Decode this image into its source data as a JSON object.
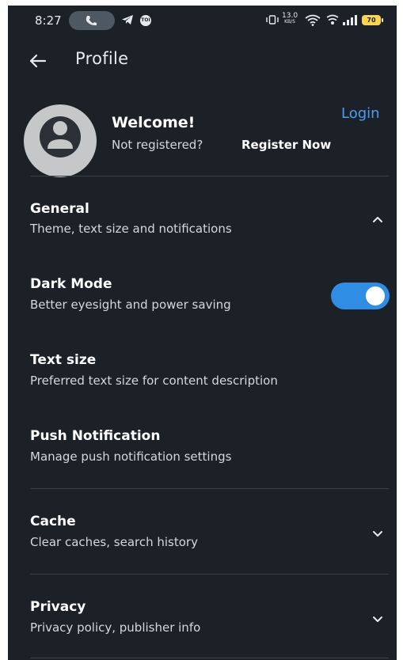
{
  "status_bar": {
    "time": "8:27",
    "toi_badge": "TOI",
    "net_speed_value": "13.0",
    "net_speed_unit": "KB/S",
    "battery_level": "70",
    "icons": [
      "phone-call-icon",
      "telegram-icon",
      "toi-icon",
      "vibrate-icon",
      "wifi-icon",
      "volte-icon",
      "signal-icon",
      "battery-icon"
    ]
  },
  "header": {
    "title": "Profile",
    "back_icon": "arrow-left-icon"
  },
  "profile": {
    "greeting": "Welcome!",
    "prompt": "Not registered?",
    "register_label": "Register Now",
    "login_label": "Login",
    "avatar_icon": "user-silhouette-icon"
  },
  "sections": {
    "general": {
      "title": "General",
      "subtitle": "Theme, text size and notifications",
      "expanded": true
    },
    "dark_mode": {
      "title": "Dark Mode",
      "subtitle": "Better eyesight and power saving",
      "enabled": true
    },
    "text_size": {
      "title": "Text size",
      "subtitle": "Preferred text size for content description"
    },
    "push": {
      "title": "Push Notification",
      "subtitle": "Manage push notification settings"
    },
    "cache": {
      "title": "Cache",
      "subtitle": "Clear caches, search history",
      "expanded": false
    },
    "privacy": {
      "title": "Privacy",
      "subtitle": "Privacy policy, publisher info",
      "expanded": false
    }
  },
  "colors": {
    "background": "#1b2127",
    "accent": "#2f8de4",
    "link": "#4a9cf5",
    "divider": "#3a4148"
  }
}
